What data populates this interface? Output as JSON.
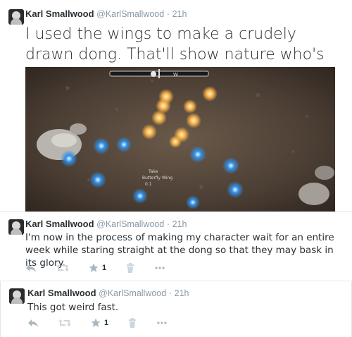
{
  "tweets": [
    {
      "user": {
        "name": "Karl Smallwood",
        "handle": "@KarlSmallwood"
      },
      "separator": "·",
      "time": "21h",
      "text": "I used the wings to make a crudely drawn dong. That'll show nature who's boss.",
      "media": {
        "hud": {
          "compass_marker": "W"
        },
        "item_label": {
          "line1": "Take",
          "line2": "Butterfly Wing",
          "line3": "0.1"
        }
      }
    },
    {
      "user": {
        "name": "Karl Smallwood",
        "handle": "@KarlSmallwood"
      },
      "separator": "·",
      "time": "21h",
      "text": "I'm now in the process of making my character wait for an entire week while staring straight at the dong so that they may bask in its glory.",
      "favorites": "1"
    },
    {
      "user": {
        "name": "Karl Smallwood",
        "handle": "@KarlSmallwood"
      },
      "separator": "·",
      "time": "21h",
      "text": "This got weird fast.",
      "favorites": "1"
    }
  ],
  "icons": {
    "reply": "reply-icon",
    "retweet": "retweet-icon",
    "favorite": "star-icon",
    "delete": "trash-icon",
    "more": "more-icon"
  }
}
